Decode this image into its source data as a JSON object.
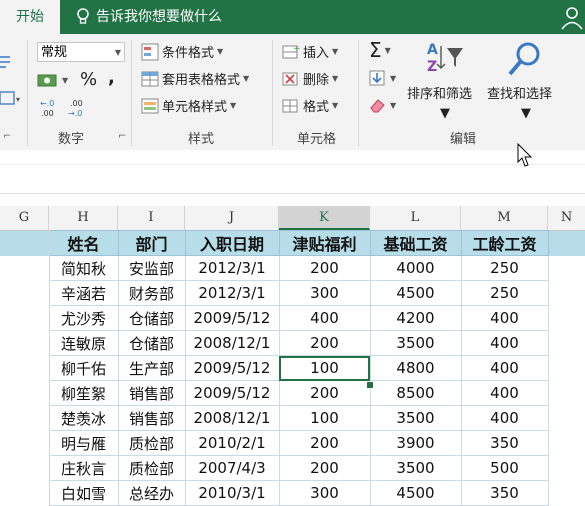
{
  "ribbon_tabs": {
    "active": "开始",
    "tell_me": "告诉我你想要做什么"
  },
  "number_group": {
    "format_value": "常规",
    "percent": "%",
    "comma": ",",
    "inc_decimal": "←.0\n.00",
    "dec_decimal": ".00\n→.0",
    "label": "数字"
  },
  "styles_group": {
    "conditional_format": "条件格式",
    "table_format": "套用表格格式",
    "cell_styles": "单元格样式",
    "label": "样式"
  },
  "cells_group": {
    "insert": "插入",
    "delete": "删除",
    "format": "格式",
    "label": "单元格"
  },
  "editing_group": {
    "sort_filter": "排序和筛选",
    "find_select": "查找和选择",
    "label": "编辑"
  },
  "columns": [
    "G",
    "H",
    "I",
    "J",
    "K",
    "L",
    "M",
    "N"
  ],
  "selected_column": "K",
  "table": {
    "headers": [
      "姓名",
      "部门",
      "入职日期",
      "津贴福利",
      "基础工资",
      "工龄工资"
    ],
    "rows": [
      [
        "简知秋",
        "安监部",
        "2012/3/1",
        "200",
        "4000",
        "250"
      ],
      [
        "辛涵若",
        "财务部",
        "2012/3/1",
        "300",
        "4500",
        "250"
      ],
      [
        "尤沙秀",
        "仓储部",
        "2009/5/12",
        "400",
        "4200",
        "400"
      ],
      [
        "连敏原",
        "仓储部",
        "2008/12/1",
        "200",
        "3500",
        "400"
      ],
      [
        "柳千佑",
        "生产部",
        "2009/5/12",
        "100",
        "4800",
        "400"
      ],
      [
        "柳笙絮",
        "销售部",
        "2009/5/12",
        "200",
        "8500",
        "400"
      ],
      [
        "楚羡冰",
        "销售部",
        "2008/12/1",
        "100",
        "3500",
        "400"
      ],
      [
        "明与雁",
        "质检部",
        "2010/2/1",
        "200",
        "3900",
        "350"
      ],
      [
        "庄秋言",
        "质检部",
        "2007/4/3",
        "200",
        "3500",
        "500"
      ],
      [
        "白如雪",
        "总经办",
        "2010/3/1",
        "300",
        "4500",
        "350"
      ]
    ]
  },
  "colors": {
    "accent": "#217346",
    "header_fill": "#b6dde8",
    "grid_line": "#c6dbe8"
  }
}
